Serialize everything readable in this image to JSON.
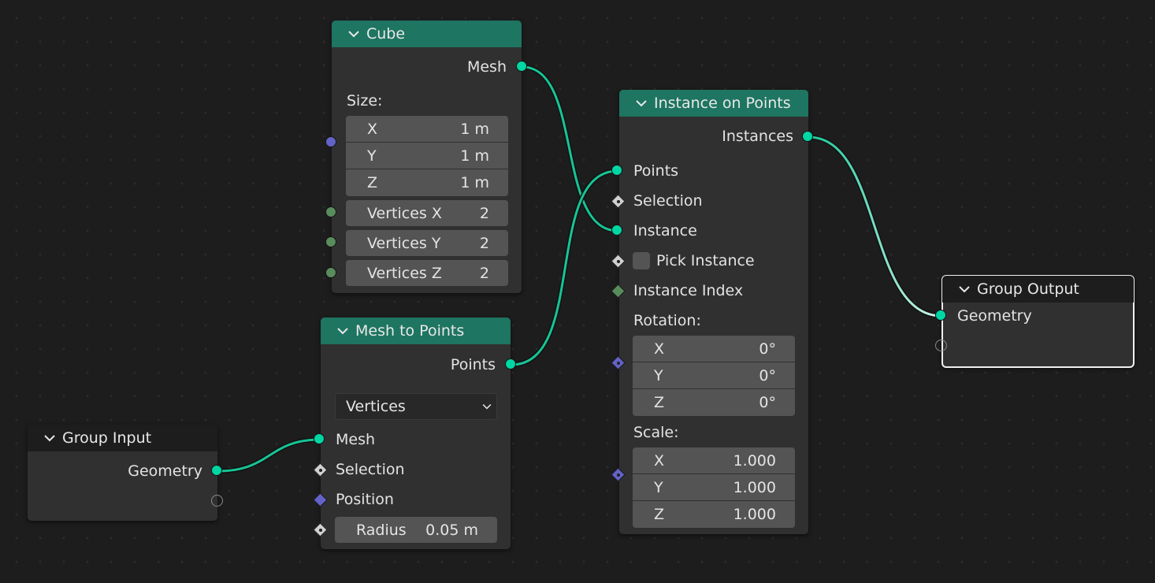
{
  "nodes": {
    "cube": {
      "title": "Cube",
      "output_mesh": "Mesh",
      "size_label": "Size:",
      "size": [
        {
          "axis": "X",
          "value": "1 m"
        },
        {
          "axis": "Y",
          "value": "1 m"
        },
        {
          "axis": "Z",
          "value": "1 m"
        }
      ],
      "vertices": [
        {
          "label": "Vertices X",
          "value": "2"
        },
        {
          "label": "Vertices Y",
          "value": "2"
        },
        {
          "label": "Vertices Z",
          "value": "2"
        }
      ]
    },
    "mesh_to_points": {
      "title": "Mesh to Points",
      "output_points": "Points",
      "mode": "Vertices",
      "input_mesh": "Mesh",
      "input_selection": "Selection",
      "input_position": "Position",
      "radius_label": "Radius",
      "radius_value": "0.05 m"
    },
    "group_input": {
      "title": "Group Input",
      "output_geometry": "Geometry"
    },
    "instance_on_points": {
      "title": "Instance on Points",
      "output_instances": "Instances",
      "input_points": "Points",
      "input_selection": "Selection",
      "input_instance": "Instance",
      "pick_instance": "Pick Instance",
      "instance_index": "Instance Index",
      "rotation_label": "Rotation:",
      "rotation": [
        {
          "axis": "X",
          "value": "0°"
        },
        {
          "axis": "Y",
          "value": "0°"
        },
        {
          "axis": "Z",
          "value": "0°"
        }
      ],
      "scale_label": "Scale:",
      "scale": [
        {
          "axis": "X",
          "value": "1.000"
        },
        {
          "axis": "Y",
          "value": "1.000"
        },
        {
          "axis": "Z",
          "value": "1.000"
        }
      ]
    },
    "group_output": {
      "title": "Group Output",
      "input_geometry": "Geometry"
    }
  },
  "colors": {
    "geometry_socket": "#00d6a3",
    "vector_socket": "#6363c7",
    "integer_socket": "#598c5c",
    "geometry_node_header": "#1e7561",
    "group_node_header": "#1d1d1d",
    "link": "#17c495"
  }
}
